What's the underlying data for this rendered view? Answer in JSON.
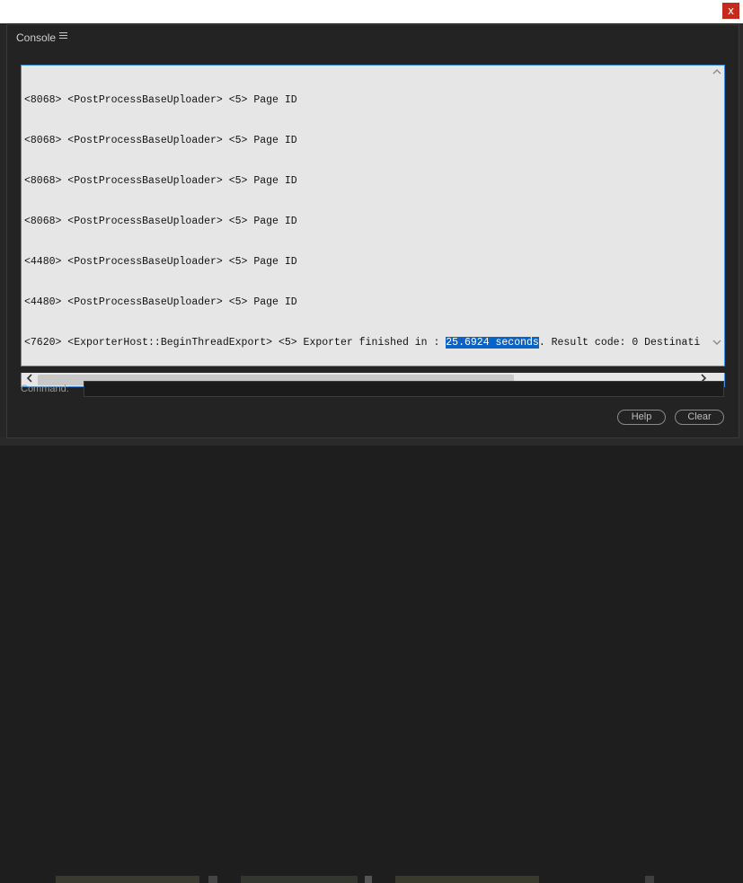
{
  "window": {
    "close_glyph": "x",
    "close_color": "#c42b1c"
  },
  "panel": {
    "title": "Console",
    "menu_icon": "hamburger-menu-icon"
  },
  "log": {
    "lines": [
      {
        "text": "<8068> <PostProcessBaseUploader> <5> Page ID"
      },
      {
        "text": "<8068> <PostProcessBaseUploader> <5> Page ID"
      },
      {
        "text": "<8068> <PostProcessBaseUploader> <5> Page ID"
      },
      {
        "text": "<8068> <PostProcessBaseUploader> <5> Page ID"
      },
      {
        "text": "<4480> <PostProcessBaseUploader> <5> Page ID"
      },
      {
        "text": "<4480> <PostProcessBaseUploader> <5> Page ID"
      },
      {
        "before": "<7620> <ExporterHost::BeginThreadExport> <5> Exporter finished in : ",
        "selected": "25.6924 seconds",
        "after": ". Result code: 0 Destinati"
      }
    ],
    "selection_color": "#0a64c8",
    "focus_border_color": "#3d8ee0"
  },
  "scrollbars": {
    "vertical": {
      "up_icon": "chevron-up-icon",
      "down_icon": "chevron-down-icon"
    },
    "horizontal": {
      "left_icon": "chevron-left-icon",
      "right_icon": "chevron-right-icon"
    }
  },
  "command": {
    "label": "Command:",
    "value": ""
  },
  "buttons": {
    "help": "Help",
    "clear": "Clear"
  }
}
